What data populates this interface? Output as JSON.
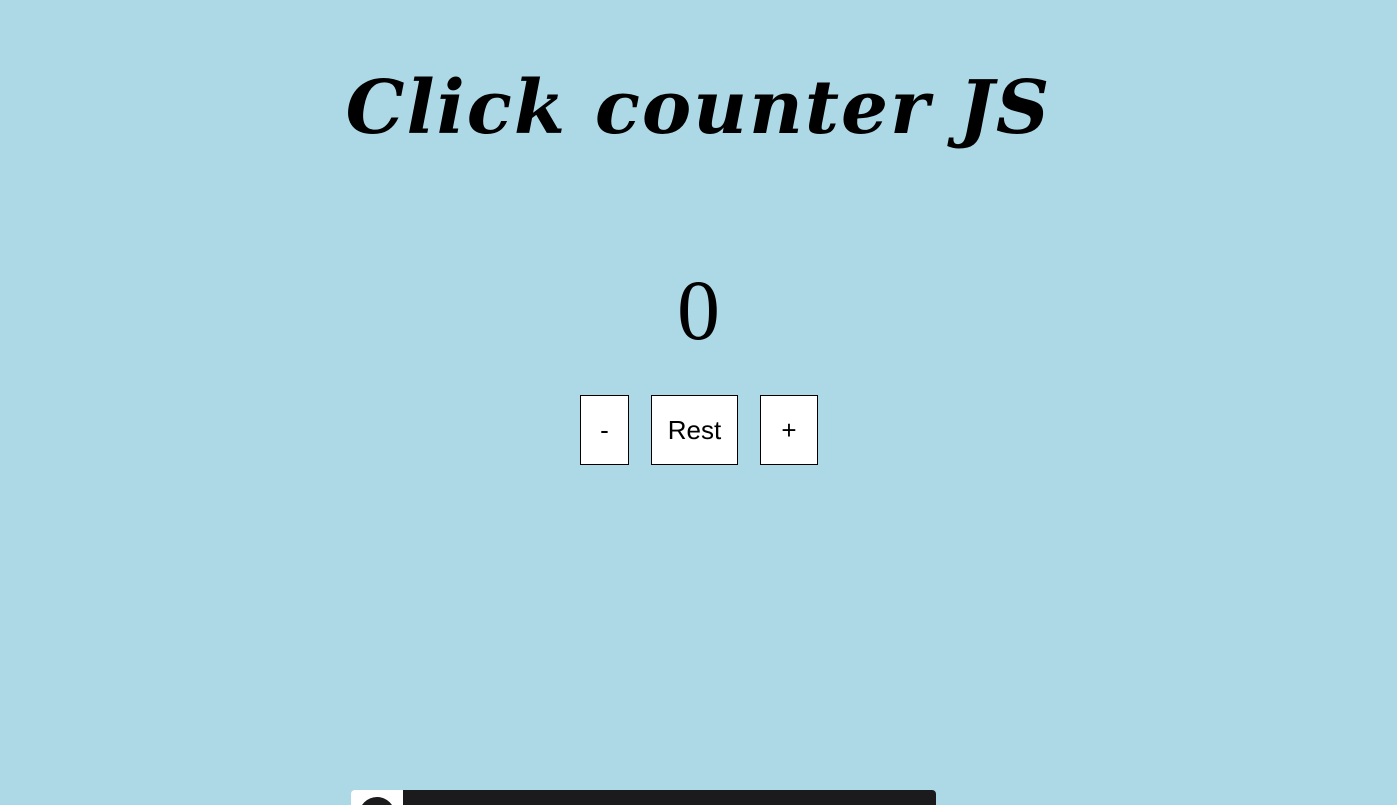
{
  "page": {
    "title": "Click counter JS",
    "background_color": "#add8e6"
  },
  "counter": {
    "value": "0"
  },
  "controls": {
    "decrement_label": "-",
    "reset_label": "Rest",
    "increment_label": "+"
  },
  "bottom_bar": {
    "left_color": "#ffffff",
    "right_color": "#1b1b1e"
  }
}
